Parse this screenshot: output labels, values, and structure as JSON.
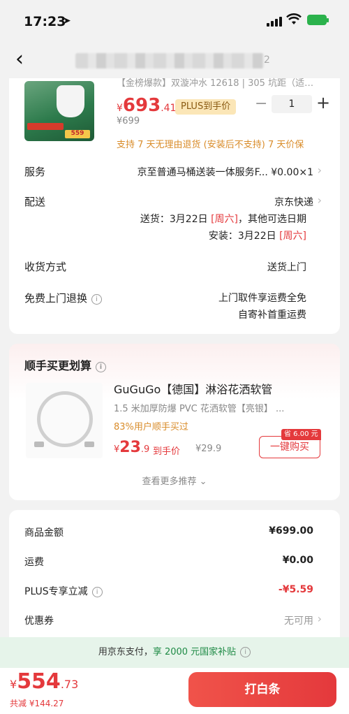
{
  "status_bar": {
    "time": "17:23"
  },
  "product": {
    "name_snippet": "【金榜爆款】双漩冲水 12618 | 305 坑距（适…",
    "price_symbol": "¥",
    "price_int": "693",
    "price_dec": ".41",
    "plus_badge": "PLUS到手价",
    "orig_price": "¥699",
    "quantity": "1",
    "qty_minus": "−",
    "qty_plus": "+",
    "return_note": "支持 7 天无理由退货 (安装后不支持)  7 天价保",
    "img_tag": "559"
  },
  "service": {
    "label": "服务",
    "value": "京至普通马桶送装一体服务F...  ¥0.00×1"
  },
  "delivery": {
    "label": "配送",
    "carrier": "京东快递",
    "ship_prefix": "送货：3月22日 ",
    "ship_day": "[周六]",
    "ship_suffix": "，其他可选日期",
    "install_prefix": "安装：3月22日 ",
    "install_day": "[周六]"
  },
  "receive": {
    "label": "收货方式",
    "value": "送货上门"
  },
  "free_return": {
    "label": "免费上门退换",
    "line1": "上门取件享运费全免",
    "line2": "自寄补首重运费"
  },
  "addon": {
    "title": "顺手买更划算",
    "item_title": "GuGuGo【德国】淋浴花洒软管",
    "item_sub": "1.5 米加厚防爆 PVC 花洒软管【亮银】 ...",
    "note": "83%用户顺手买过",
    "price_sym": "¥",
    "price_int": "23",
    "price_dec": ".9",
    "price_label": "到手价",
    "orig": "¥29.9",
    "save_badge": "省 6.00 元",
    "buy_button": "一键购买",
    "more": "查看更多推荐 ⌄"
  },
  "summary": {
    "goods_label": "商品金额",
    "goods_value": "¥699.00",
    "shipping_label": "运费",
    "shipping_value": "¥0.00",
    "plus_label": "PLUS专享立减",
    "plus_value": "-¥5.59",
    "coupon_label": "优惠券",
    "coupon_value": "无可用"
  },
  "subsidy": {
    "prefix": "用京东支付，",
    "highlight": "享 2000 元国家补贴"
  },
  "bottom": {
    "total_sym": "¥",
    "total_int": "554",
    "total_dec": ".73",
    "saved": "共减 ¥144.27",
    "pay_button": "打白条"
  }
}
